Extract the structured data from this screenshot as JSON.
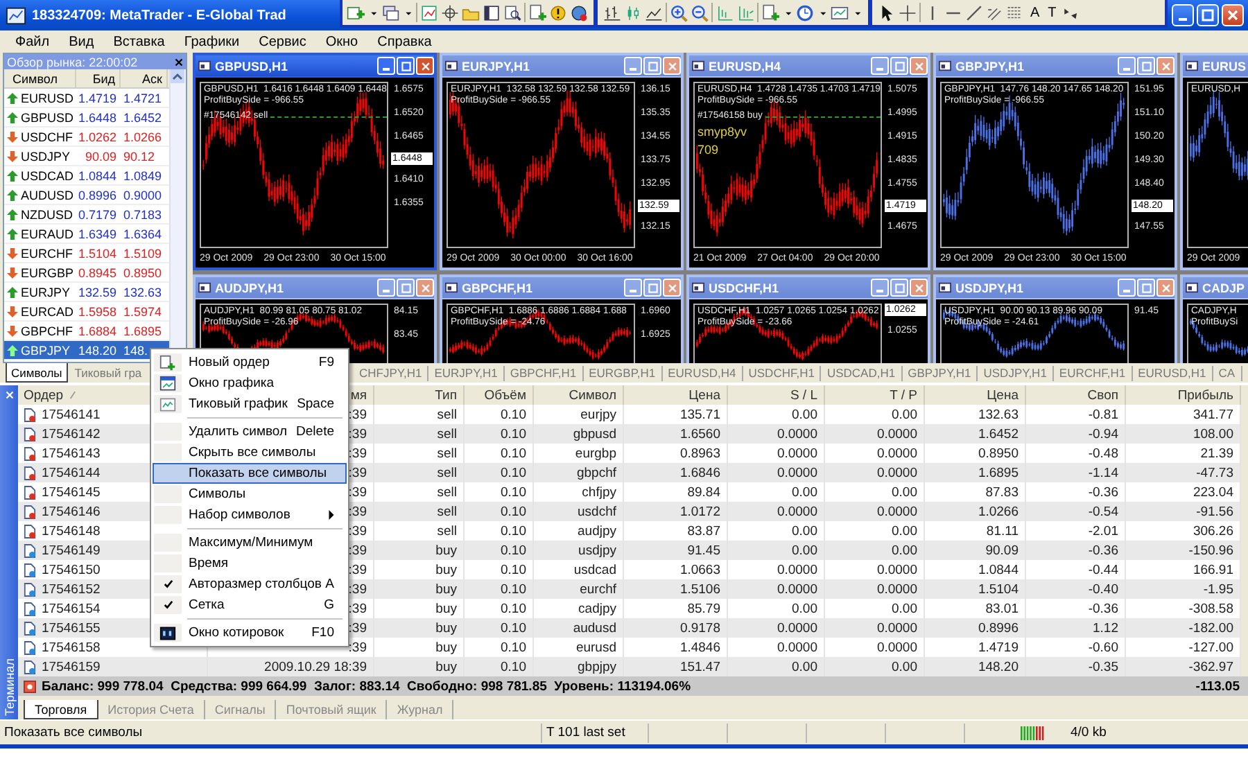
{
  "window": {
    "title": "183324709: MetaTrader - E-Global Trad"
  },
  "toolbar": {
    "text_tools": [
      "A",
      "T"
    ]
  },
  "menu_bar": [
    "Файл",
    "Вид",
    "Вставка",
    "Графики",
    "Сервис",
    "Окно",
    "Справка"
  ],
  "market_watch": {
    "title": "Обзор рынка: 22:00:02",
    "columns": [
      "Символ",
      "Бид",
      "Аск"
    ],
    "rows": [
      {
        "symbol": "EURUSD",
        "bid": "1.4719",
        "ask": "1.4721",
        "rising": true,
        "selected": false
      },
      {
        "symbol": "GBPUSD",
        "bid": "1.6448",
        "ask": "1.6452",
        "rising": true,
        "selected": false
      },
      {
        "symbol": "USDCHF",
        "bid": "1.0262",
        "ask": "1.0266",
        "rising": false,
        "selected": false
      },
      {
        "symbol": "USDJPY",
        "bid": "90.09",
        "ask": "90.12",
        "rising": false,
        "selected": false
      },
      {
        "symbol": "USDCAD",
        "bid": "1.0844",
        "ask": "1.0849",
        "rising": true,
        "selected": false
      },
      {
        "symbol": "AUDUSD",
        "bid": "0.8996",
        "ask": "0.9000",
        "rising": true,
        "selected": false
      },
      {
        "symbol": "NZDUSD",
        "bid": "0.7179",
        "ask": "0.7183",
        "rising": true,
        "selected": false
      },
      {
        "symbol": "EURAUD",
        "bid": "1.6349",
        "ask": "1.6364",
        "rising": true,
        "selected": false
      },
      {
        "symbol": "EURCHF",
        "bid": "1.5104",
        "ask": "1.5109",
        "rising": false,
        "selected": false
      },
      {
        "symbol": "EURGBP",
        "bid": "0.8945",
        "ask": "0.8950",
        "rising": false,
        "selected": false
      },
      {
        "symbol": "EURJPY",
        "bid": "132.59",
        "ask": "132.63",
        "rising": true,
        "selected": false
      },
      {
        "symbol": "EURCAD",
        "bid": "1.5958",
        "ask": "1.5974",
        "rising": false,
        "selected": false
      },
      {
        "symbol": "GBPCHF",
        "bid": "1.6884",
        "ask": "1.6895",
        "rising": false,
        "selected": false
      },
      {
        "symbol": "GBPJPY",
        "bid": "148.20",
        "ask": "148.",
        "rising": true,
        "selected": true
      }
    ],
    "tabs": [
      {
        "label": "Символы",
        "selected": true
      },
      {
        "label": "Тиковый гра",
        "selected": false
      }
    ]
  },
  "charts": [
    {
      "title": "GBPUSD,H1",
      "active": true,
      "color": "#ff0000",
      "lines": [
        {
          "kind": "info",
          "text": "GBPUSD,H1  1.6416 1.6448 1.6409 1.6448"
        },
        {
          "kind": "info",
          "text": "ProfitBuySide = -966.55"
        },
        {
          "kind": "order",
          "text": "#17546142 sell"
        }
      ],
      "ticks": [
        "1.6575",
        "1.6520",
        "1.6465",
        "1.6410",
        "1.6355"
      ],
      "price_tag": "1.6448",
      "times": [
        "29 Oct 2009",
        "29 Oct 23:00",
        "30 Oct 15:00"
      ]
    },
    {
      "title": "EURJPY,H1",
      "active": false,
      "color": "#ff0000",
      "lines": [
        {
          "kind": "info",
          "text": "EURJPY,H1  132.58 132.59 132.58 132.59"
        },
        {
          "kind": "info",
          "text": "ProfitBuySide = -966.55"
        }
      ],
      "ticks": [
        "136.15",
        "135.35",
        "134.55",
        "133.75",
        "132.95",
        "132.15"
      ],
      "price_tag": "132.59",
      "times": [
        "29 Oct 2009",
        "30 Oct 00:00",
        "30 Oct 16:00"
      ]
    },
    {
      "title": "EURUSD,H4",
      "active": false,
      "color": "#ff0000",
      "lines": [
        {
          "kind": "info",
          "text": "EURUSD,H4  1.4728 1.4735 1.4703 1.4719"
        },
        {
          "kind": "info",
          "text": "ProfitBuySide = -966.55"
        },
        {
          "kind": "order",
          "text": "#17546158 buy"
        },
        {
          "kind": "note",
          "text": "smyp8yv"
        },
        {
          "kind": "note",
          "text": "709"
        }
      ],
      "ticks": [
        "1.5075",
        "1.4995",
        "1.4915",
        "1.4835",
        "1.4755",
        "1.4675"
      ],
      "price_tag": "1.4719",
      "times": [
        "21 Oct 2009",
        "27 Oct 04:00",
        "29 Oct 20:00"
      ]
    },
    {
      "title": "GBPJPY,H1",
      "active": false,
      "color": "#4a72e8",
      "lines": [
        {
          "kind": "info",
          "text": "GBPJPY,H1  147.76 148.20 147.65 148.20"
        },
        {
          "kind": "info",
          "text": "ProfitBuySide = -966.55"
        }
      ],
      "ticks": [
        "151.95",
        "151.10",
        "150.20",
        "149.30",
        "148.40",
        "147.55"
      ],
      "price_tag": "148.20",
      "times": [
        "29 Oct 2009",
        "29 Oct 23:00",
        "30 Oct 15:00"
      ]
    },
    {
      "title": "EURUS",
      "active": false,
      "color": "#4a72e8",
      "lines": [
        {
          "kind": "info",
          "text": "EURUSD,H"
        }
      ],
      "times": [
        "29 Oct 2009"
      ]
    },
    {
      "title": "AUDJPY,H1",
      "active": false,
      "color": "#ff0000",
      "lines": [
        {
          "kind": "info",
          "text": "AUDJPY,H1  80.99 81.05 80.75 81.02"
        },
        {
          "kind": "info",
          "text": "ProfitBuySide = -26.96"
        }
      ],
      "ticks": [
        "84.15",
        "83.45"
      ]
    },
    {
      "title": "GBPCHF,H1",
      "active": false,
      "color": "#ff0000",
      "lines": [
        {
          "kind": "info",
          "text": "GBPCHF,H1  1.6886 1.6886 1.6884 1.688"
        },
        {
          "kind": "info",
          "text": "ProfitBuySide = -24.76"
        }
      ],
      "ticks": [
        "1.6960",
        "1.6925"
      ]
    },
    {
      "title": "USDCHF,H1",
      "active": false,
      "color": "#ff0000",
      "lines": [
        {
          "kind": "info",
          "text": "USDCHF,H1  1.0257 1.0265 1.0254 1.0262"
        },
        {
          "kind": "info",
          "text": "ProfitBuySide = -23.66"
        }
      ],
      "ticks": [
        "1.0255"
      ],
      "price_tag": "1.0262"
    },
    {
      "title": "USDJPY,H1",
      "active": false,
      "color": "#4a72e8",
      "lines": [
        {
          "kind": "info",
          "text": "USDJPY,H1  90.00 90.13 89.96 90.09"
        },
        {
          "kind": "info",
          "text": "ProfitBuySide = -24.61"
        }
      ],
      "ticks": [
        "91.45"
      ]
    },
    {
      "title": "CADJP",
      "active": false,
      "color": "#4a72e8",
      "lines": [
        {
          "kind": "info",
          "text": "CADJPY,H"
        },
        {
          "kind": "info",
          "text": "ProfitBuySi"
        }
      ]
    }
  ],
  "chart_tabs": [
    "CHFJPY,H1",
    "EURJPY,H1",
    "GBPCHF,H1",
    "EURGBP,H1",
    "EURUSD,H4",
    "USDCHF,H1",
    "USDCAD,H1",
    "GBPJPY,H1",
    "USDJPY,H1",
    "EURCHF,H1",
    "EURUSD,H1",
    "CA"
  ],
  "terminal": {
    "title": "Терминал",
    "columns": [
      "Ордер",
      "мя",
      "Тип",
      "Объём",
      "Символ",
      "Цена",
      "S / L",
      "T / P",
      "Цена",
      "Своп",
      "Прибыль"
    ],
    "rows": [
      {
        "kind": "sell",
        "cells": [
          "17546141",
          ":39",
          "sell",
          "0.10",
          "eurjpy",
          "135.71",
          "0.00",
          "0.00",
          "132.63",
          "-0.81",
          "341.77"
        ]
      },
      {
        "kind": "sell",
        "cells": [
          "17546142",
          ":39",
          "sell",
          "0.10",
          "gbpusd",
          "1.6560",
          "0.0000",
          "0.0000",
          "1.6452",
          "-0.94",
          "108.00"
        ]
      },
      {
        "kind": "sell",
        "cells": [
          "17546143",
          ":39",
          "sell",
          "0.10",
          "eurgbp",
          "0.8963",
          "0.0000",
          "0.0000",
          "0.8950",
          "-0.48",
          "21.39"
        ]
      },
      {
        "kind": "sell",
        "cells": [
          "17546144",
          ":39",
          "sell",
          "0.10",
          "gbpchf",
          "1.6846",
          "0.0000",
          "0.0000",
          "1.6895",
          "-1.14",
          "-47.73"
        ]
      },
      {
        "kind": "sell",
        "cells": [
          "17546145",
          ":39",
          "sell",
          "0.10",
          "chfjpy",
          "89.84",
          "0.00",
          "0.00",
          "87.83",
          "-0.36",
          "223.04"
        ]
      },
      {
        "kind": "sell",
        "cells": [
          "17546146",
          ":39",
          "sell",
          "0.10",
          "usdchf",
          "1.0172",
          "0.0000",
          "0.0000",
          "1.0266",
          "-0.54",
          "-91.56"
        ]
      },
      {
        "kind": "sell",
        "cells": [
          "17546148",
          ":39",
          "sell",
          "0.10",
          "audjpy",
          "83.87",
          "0.00",
          "0.00",
          "81.11",
          "-2.01",
          "306.26"
        ]
      },
      {
        "kind": "buy",
        "cells": [
          "17546149",
          ":39",
          "buy",
          "0.10",
          "usdjpy",
          "91.45",
          "0.00",
          "0.00",
          "90.09",
          "-0.36",
          "-150.96"
        ]
      },
      {
        "kind": "buy",
        "cells": [
          "17546150",
          ":39",
          "buy",
          "0.10",
          "usdcad",
          "1.0663",
          "0.0000",
          "0.0000",
          "1.0844",
          "-0.44",
          "166.91"
        ]
      },
      {
        "kind": "buy",
        "cells": [
          "17546152",
          ":39",
          "buy",
          "0.10",
          "eurchf",
          "1.5106",
          "0.0000",
          "0.0000",
          "1.5104",
          "-0.40",
          "-1.95"
        ]
      },
      {
        "kind": "buy",
        "cells": [
          "17546154",
          ":39",
          "buy",
          "0.10",
          "cadjpy",
          "85.79",
          "0.00",
          "0.00",
          "83.01",
          "-0.36",
          "-308.58"
        ]
      },
      {
        "kind": "buy",
        "cells": [
          "17546155",
          ":39",
          "buy",
          "0.10",
          "audusd",
          "0.9178",
          "0.0000",
          "0.0000",
          "0.8996",
          "1.12",
          "-182.00"
        ]
      },
      {
        "kind": "buy",
        "cells": [
          "17546158",
          ":39",
          "buy",
          "0.10",
          "eurusd",
          "1.4846",
          "0.0000",
          "0.0000",
          "1.4719",
          "-0.60",
          "-127.00"
        ]
      },
      {
        "kind": "buy",
        "cells": [
          "17546159",
          "2009.10.29 18:39",
          "buy",
          "0.10",
          "gbpjpy",
          "151.47",
          "0.00",
          "0.00",
          "148.20",
          "-0.35",
          "-362.97"
        ]
      }
    ],
    "summary": "Баланс: 999 778.04  Средства: 999 664.99  Залог: 883.14  Свободно: 998 781.85  Уровень: 113194.06%",
    "total": "-113.05",
    "tabs": [
      {
        "label": "Торговля",
        "selected": true
      },
      {
        "label": "История Счета",
        "selected": false
      },
      {
        "label": "Сигналы",
        "selected": false
      },
      {
        "label": "Почтовый ящик",
        "selected": false
      },
      {
        "label": "Журнал",
        "selected": false
      }
    ]
  },
  "context_menu": {
    "items": [
      {
        "kind": "command",
        "label": "Новый ордер",
        "shortcut": "F9",
        "checked": false,
        "submenu": false,
        "selected": false
      },
      {
        "kind": "command",
        "label": "Окно графика",
        "checked": false,
        "submenu": false,
        "selected": false
      },
      {
        "kind": "command",
        "label": "Тиковый график",
        "shortcut": "Space",
        "checked": false,
        "submenu": false,
        "selected": false
      },
      {
        "kind": "separator"
      },
      {
        "kind": "command",
        "label": "Удалить символ",
        "shortcut": "Delete",
        "checked": false,
        "submenu": false,
        "selected": false
      },
      {
        "kind": "command",
        "label": "Скрыть все символы",
        "checked": false,
        "submenu": false,
        "selected": false
      },
      {
        "kind": "command",
        "label": "Показать все символы",
        "checked": false,
        "submenu": false,
        "selected": true
      },
      {
        "kind": "command",
        "label": "Символы",
        "checked": false,
        "submenu": false,
        "selected": false
      },
      {
        "kind": "command",
        "label": "Набор символов",
        "checked": false,
        "submenu": true,
        "selected": false
      },
      {
        "kind": "separator"
      },
      {
        "kind": "command",
        "label": "Максимум/Минимум",
        "checked": false,
        "submenu": false,
        "selected": false
      },
      {
        "kind": "command",
        "label": "Время",
        "checked": false,
        "submenu": false,
        "selected": false
      },
      {
        "kind": "command",
        "label": "Авторазмер столбцов",
        "shortcut": "A",
        "checked": true,
        "submenu": false,
        "selected": false
      },
      {
        "kind": "command",
        "label": "Сетка",
        "shortcut": "G",
        "checked": true,
        "submenu": false,
        "selected": false
      },
      {
        "kind": "separator"
      },
      {
        "kind": "command",
        "label": "Окно котировок",
        "shortcut": "F10",
        "checked": false,
        "submenu": false,
        "selected": false
      }
    ]
  },
  "status_bar": {
    "message": "Показать все символы",
    "info": "T 101 last set",
    "traffic": "4/0 kb"
  }
}
